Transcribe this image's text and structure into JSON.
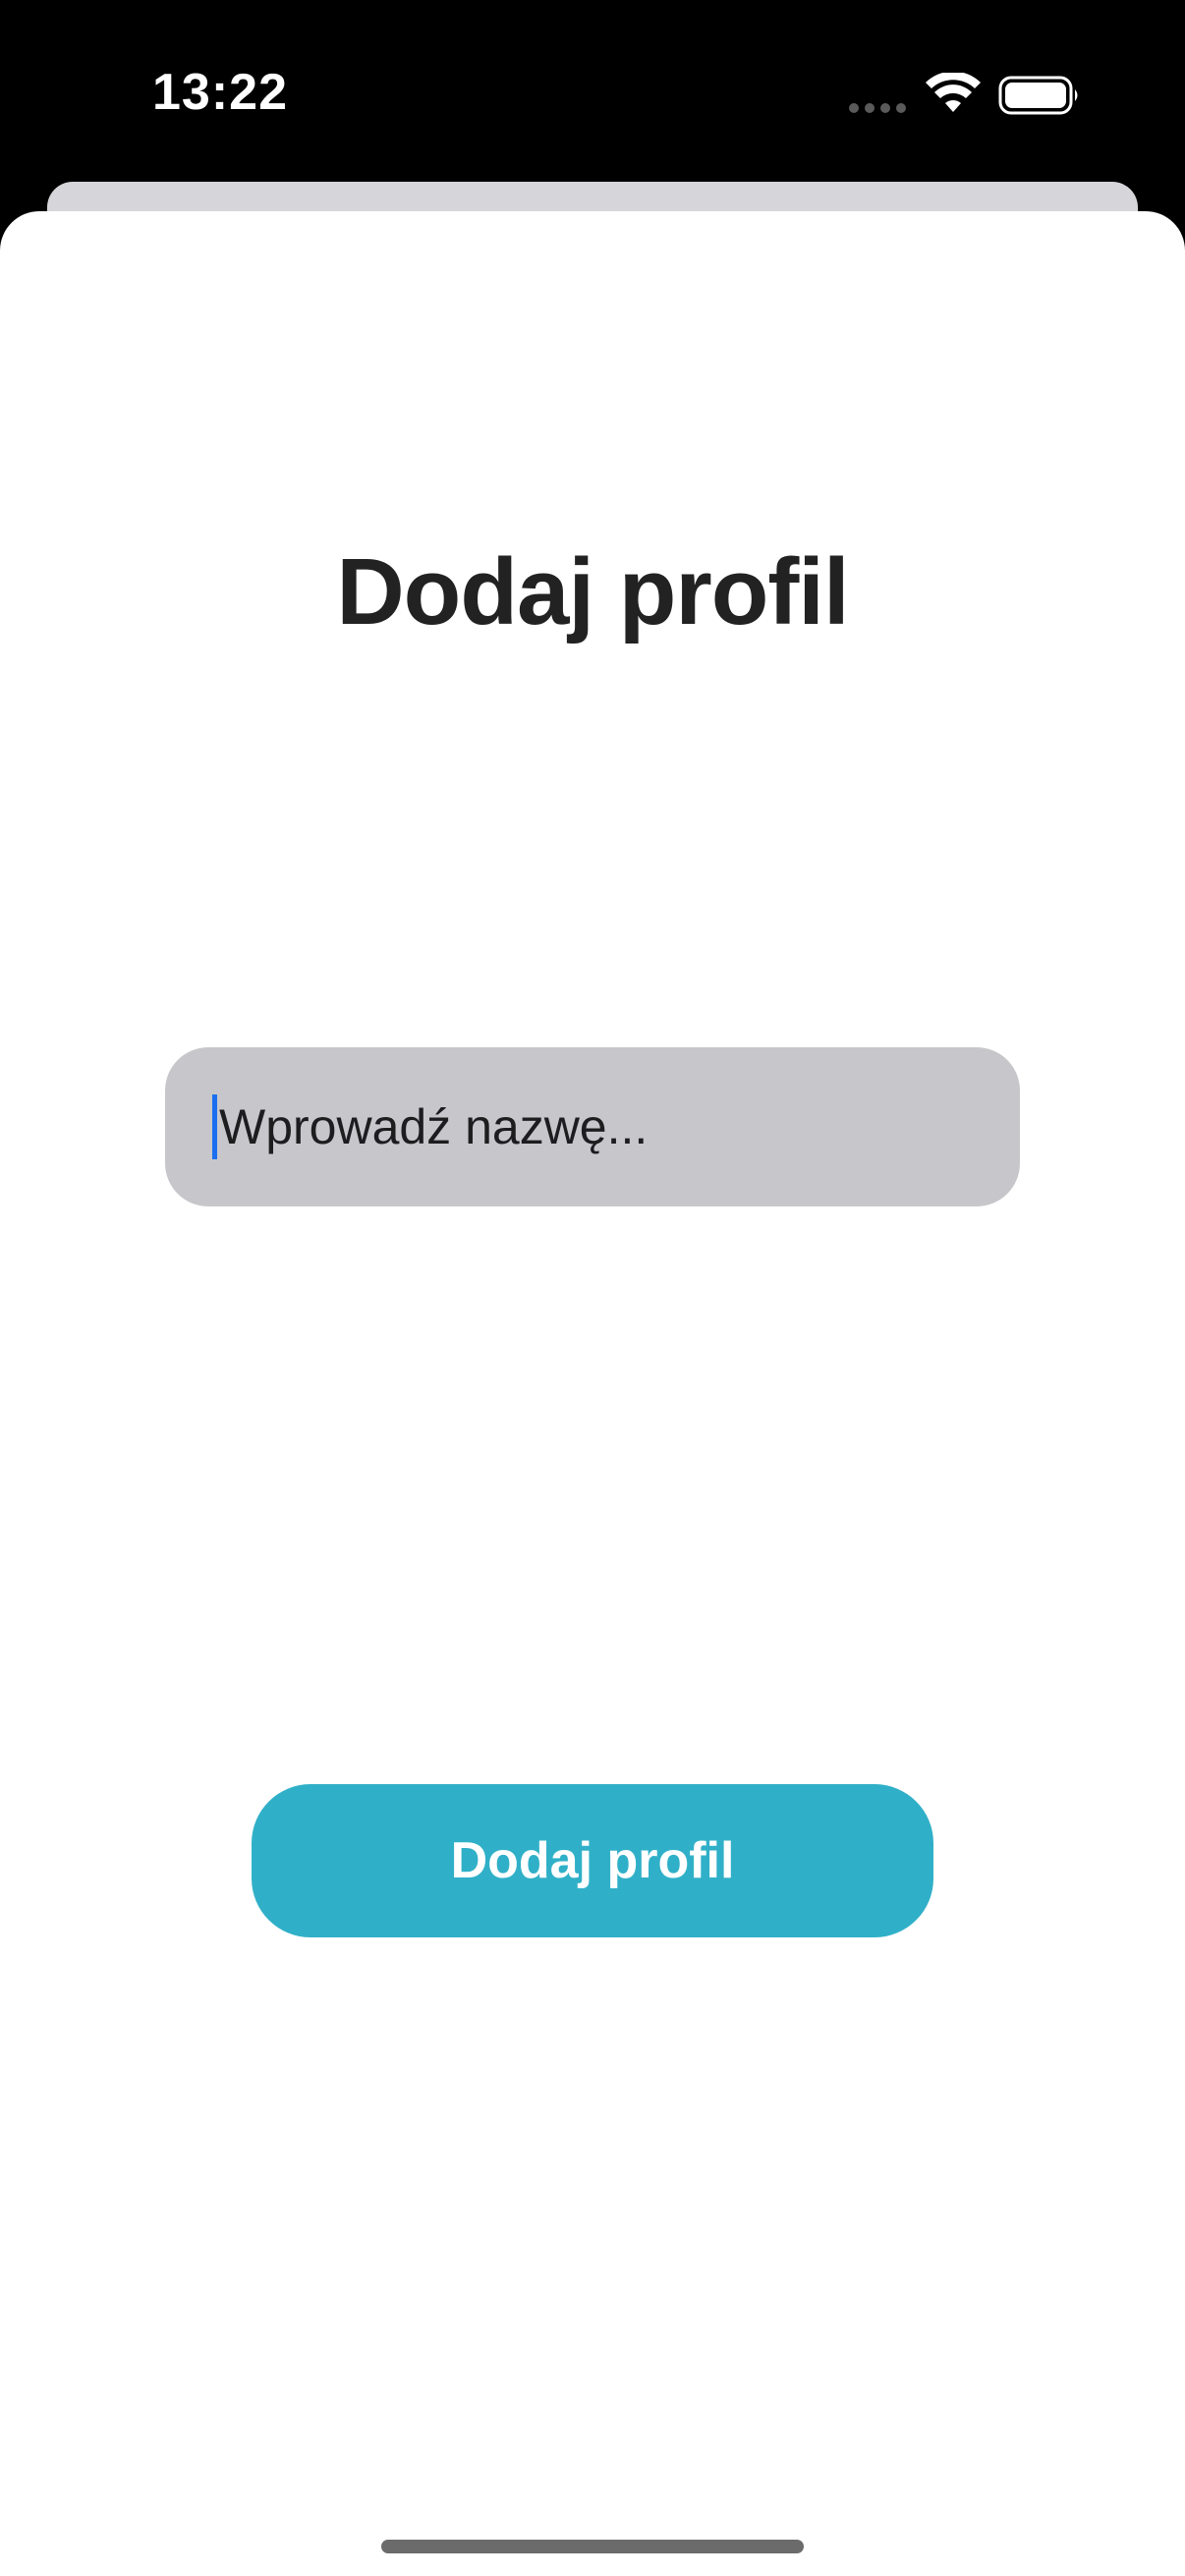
{
  "status_bar": {
    "time": "13:22",
    "icons": [
      "cellular-dots-icon",
      "wifi-icon",
      "battery-icon"
    ]
  },
  "sheet": {
    "title": "Dodaj profil",
    "name_input": {
      "placeholder": "Wprowadź nazwę...",
      "value": ""
    },
    "add_button_label": "Dodaj profil"
  },
  "colors": {
    "accent": "#30b0c8",
    "input_background": "#c7c7cb",
    "caret": "#1a6ff0",
    "title_text": "#222222"
  }
}
